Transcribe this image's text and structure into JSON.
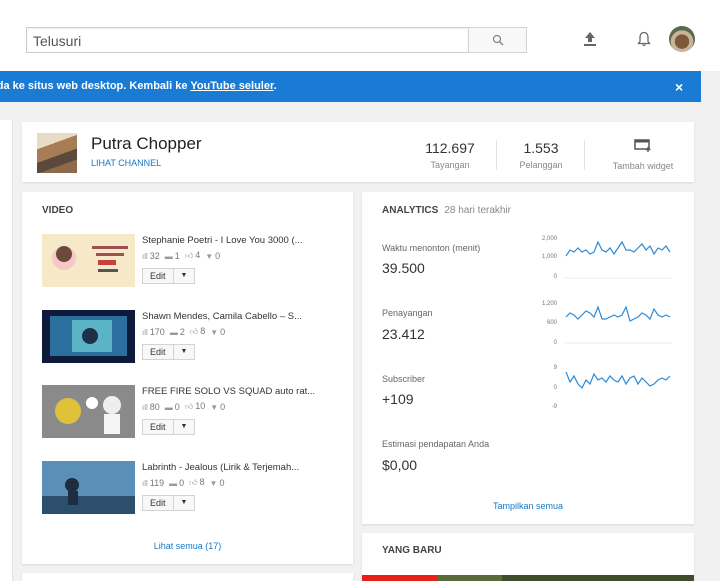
{
  "search": {
    "placeholder": "Telusuri"
  },
  "banner": {
    "text": "nda ke situs web desktop. Kembali ke ",
    "link": "YouTube seluler",
    "after": ".",
    "close": "×"
  },
  "channel": {
    "name": "Putra Chopper",
    "link": "LIHAT CHANNEL",
    "views_value": "112.697",
    "views_label": "Tayangan",
    "subs_value": "1.553",
    "subs_label": "Pelanggan",
    "widget_label": "Tambah widget"
  },
  "videos": {
    "title": "VIDEO",
    "see_all": "Lihat semua (17)",
    "edit_label": "Edit",
    "items": [
      {
        "title": "Stephanie Poetri - I Love You 3000 (...",
        "views": "32",
        "comments": "1",
        "likes": "4",
        "dislikes": "0"
      },
      {
        "title": "Shawn Mendes, Camila Cabello – S...",
        "views": "170",
        "comments": "2",
        "likes": "8",
        "dislikes": "0"
      },
      {
        "title": "FREE FIRE SOLO VS SQUAD auto rat...",
        "views": "80",
        "comments": "0",
        "likes": "10",
        "dislikes": "0"
      },
      {
        "title": "Labrinth - Jealous (Lirik & Terjemah...",
        "views": "119",
        "comments": "0",
        "likes": "8",
        "dislikes": "0"
      }
    ]
  },
  "analytics": {
    "title": "ANALYTICS",
    "subtitle": "28 hari terakhir",
    "show_all": "Tampilkan semua",
    "metrics": [
      {
        "label": "Waktu menonton (menit)",
        "value": "39.500",
        "ticks": [
          "2,000",
          "1,000",
          "0"
        ]
      },
      {
        "label": "Penayangan",
        "value": "23.412",
        "ticks": [
          "1,200",
          "600",
          "0"
        ]
      },
      {
        "label": "Subscriber",
        "value": "+109",
        "ticks": [
          "9",
          "0",
          "-9"
        ]
      },
      {
        "label": "Estimasi pendapatan Anda",
        "value": "$0,00"
      }
    ]
  },
  "whats_new": {
    "title": "YANG BARU"
  },
  "colors": {
    "accent": "#167ac6",
    "banner": "#1a7bd4",
    "spark": "#2c8bd8"
  }
}
